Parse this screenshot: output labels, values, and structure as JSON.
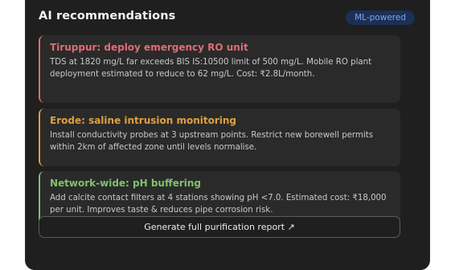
{
  "panel": {
    "title": "AI recommendations",
    "badge": "ML-powered"
  },
  "cards": [
    {
      "title": "Tiruppur: deploy emergency RO unit",
      "body": "TDS at 1820 mg/L far exceeds BIS IS:10500 limit of 500 mg/L. Mobile RO plant deployment estimated to reduce to 62 mg/L. Cost: ₹2.8L/month.",
      "accent": "#e06c75"
    },
    {
      "title": "Erode: saline intrusion monitoring",
      "body": "Install conductivity probes at 3 upstream points. Restrict new borewell permits within 2km of affected zone until levels normalise.",
      "accent": "#e0a040"
    },
    {
      "title": "Network-wide: pH buffering",
      "body": "Add calcite contact filters at 4 stations showing pH <7.0. Estimated cost: ₹18,000 per unit. Improves taste & reduces pipe corrosion risk.",
      "accent": "#7fc26a"
    }
  ],
  "action": {
    "label": "Generate full purification report ↗"
  }
}
